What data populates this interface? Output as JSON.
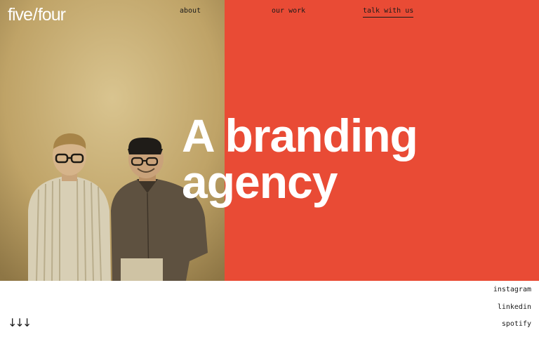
{
  "brand": {
    "logo_left": "five",
    "logo_slash": "/",
    "logo_right": "four"
  },
  "nav": {
    "about": "about",
    "our_work": "our work",
    "talk": "talk with us"
  },
  "hero": {
    "headline_line1": "A branding",
    "headline_line2": "agency",
    "accent_color": "#e94b35",
    "photo_description_icon": "team-photo"
  },
  "social": {
    "instagram": "instagram",
    "linkedin": "linkedin",
    "spotify": "spotify"
  },
  "scroll": {
    "arrows": "↓↓↓",
    "icon": "scroll-down-arrows-icon"
  }
}
